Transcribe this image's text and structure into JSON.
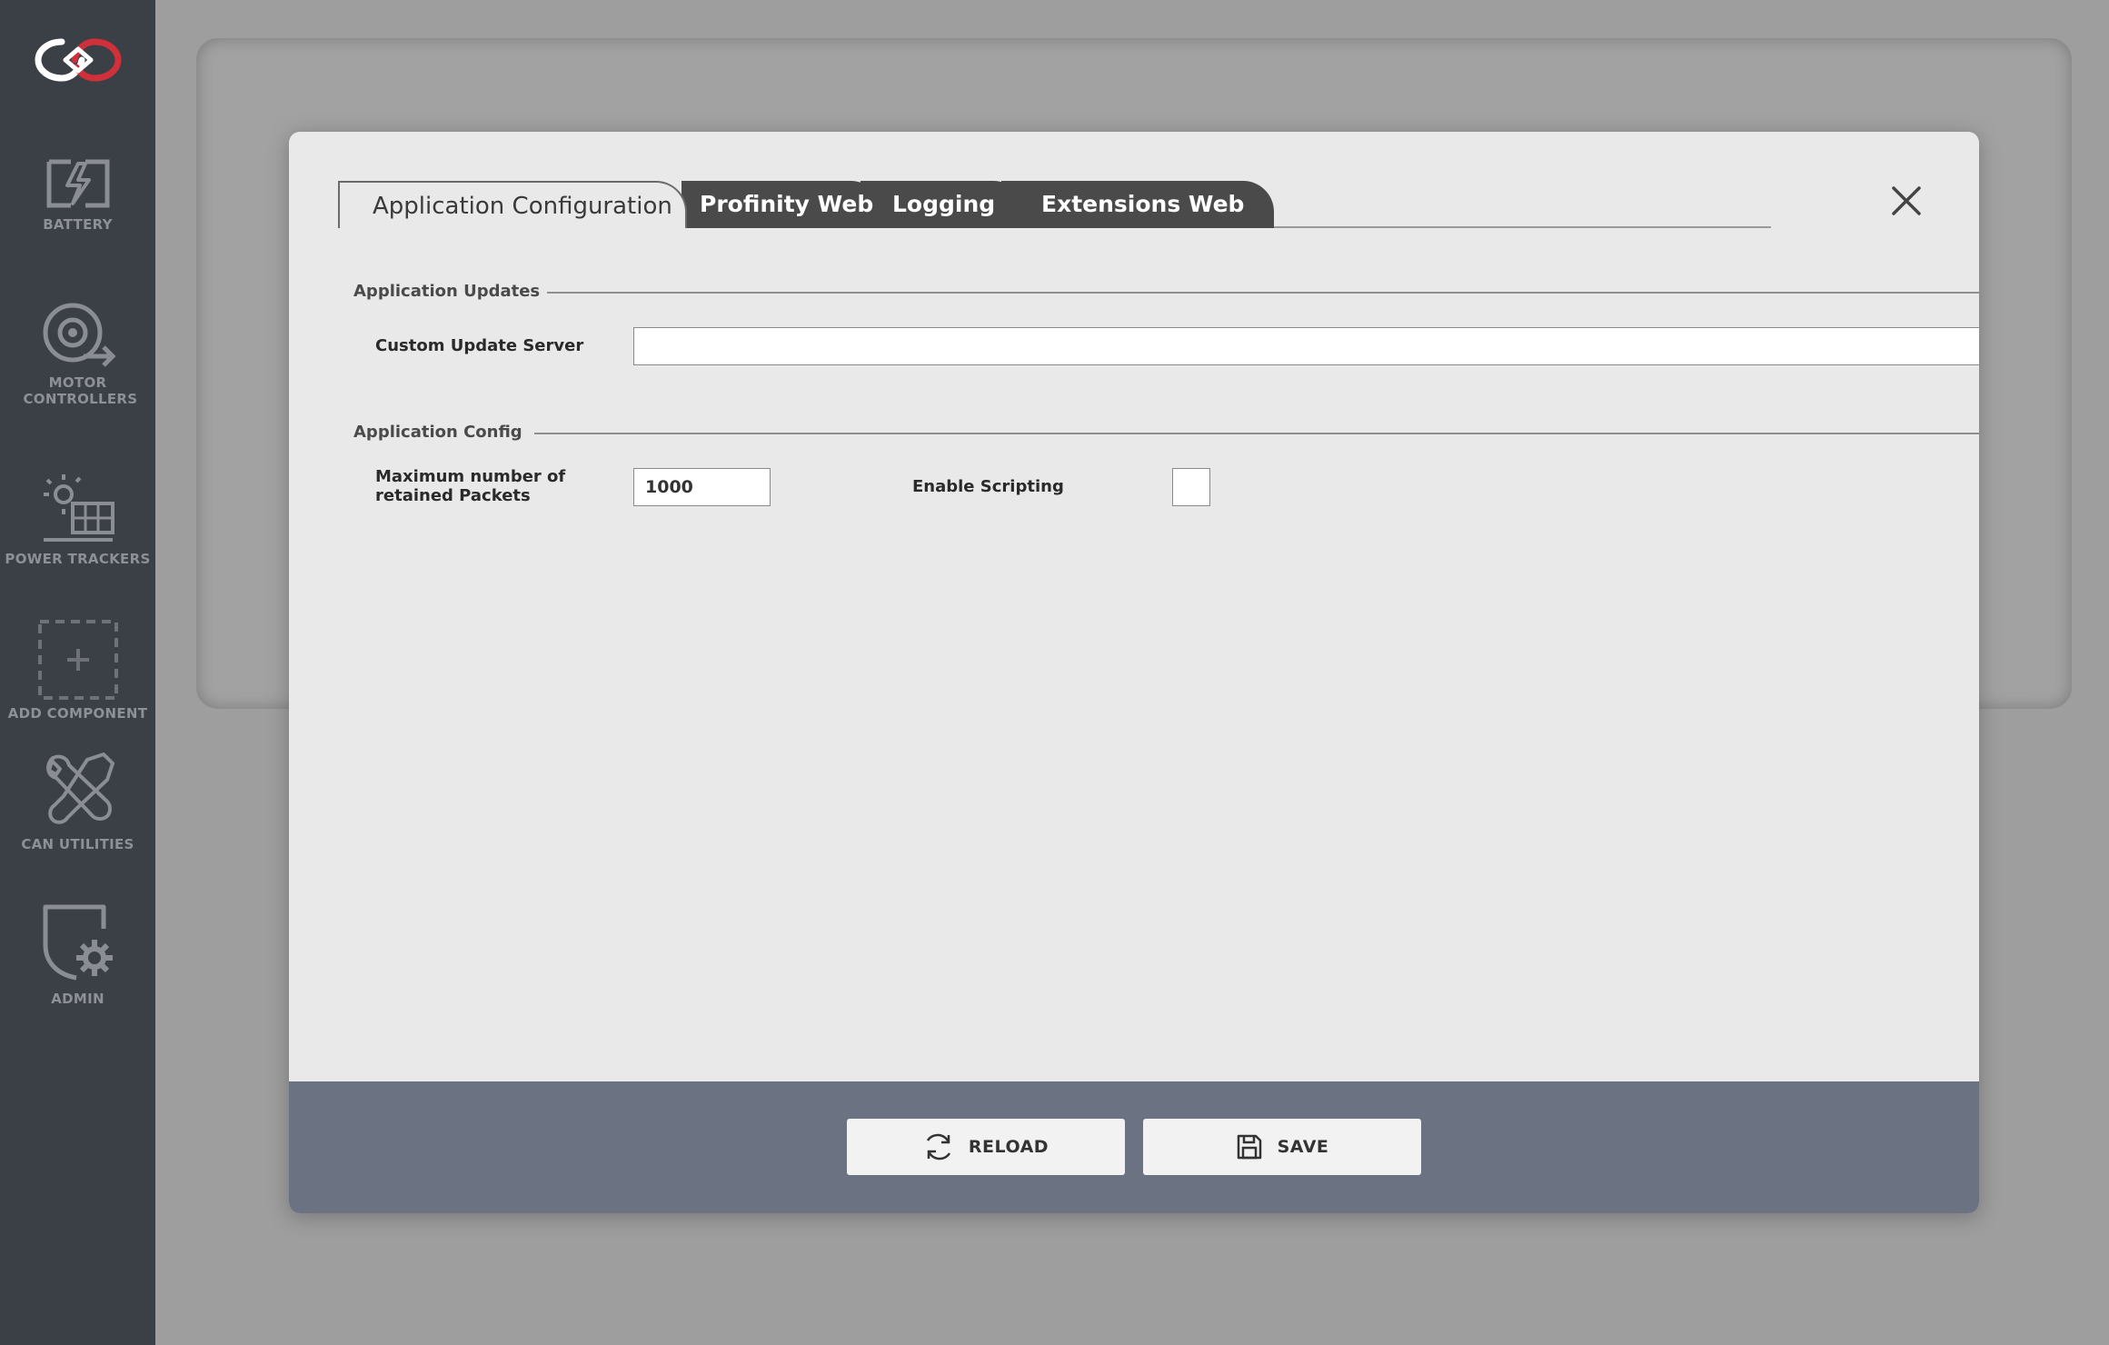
{
  "sidebar": {
    "items": [
      {
        "label": "BATTERY",
        "icon": "battery-icon"
      },
      {
        "label": "MOTOR CONTROLLERS",
        "icon": "motor-controller-icon"
      },
      {
        "label": "POWER TRACKERS",
        "icon": "solar-panel-icon"
      },
      {
        "label": "ADD COMPONENT",
        "icon": "add-component-icon"
      },
      {
        "label": "CAN UTILITIES",
        "icon": "tools-icon"
      },
      {
        "label": "ADMIN",
        "icon": "admin-settings-icon"
      }
    ],
    "logo_colors": {
      "white": "#ffffff",
      "red": "#d0303a"
    }
  },
  "modal": {
    "tabs": [
      {
        "label": "Application Configuration",
        "active": true
      },
      {
        "label": "Profinity Web",
        "active": false
      },
      {
        "label": "Logging",
        "active": false
      },
      {
        "label": "Extensions Web",
        "active": false
      }
    ],
    "sections": {
      "updates": {
        "title": "Application Updates",
        "custom_update_server_label": "Custom Update Server",
        "custom_update_server_value": ""
      },
      "config": {
        "title": "Application Config",
        "max_packets_label_line1": "Maximum number of",
        "max_packets_label_line2": "retained Packets",
        "max_packets_value": "1000",
        "enable_scripting_label": "Enable Scripting",
        "enable_scripting_checked": false
      }
    },
    "footer": {
      "reload_label": "RELOAD",
      "save_label": "SAVE"
    }
  },
  "colors": {
    "sidebar_bg": "#3b3f46",
    "modal_bg": "#e9e9e9",
    "footer_bg": "#6b7383",
    "tab_dark": "#4a4a4a"
  }
}
